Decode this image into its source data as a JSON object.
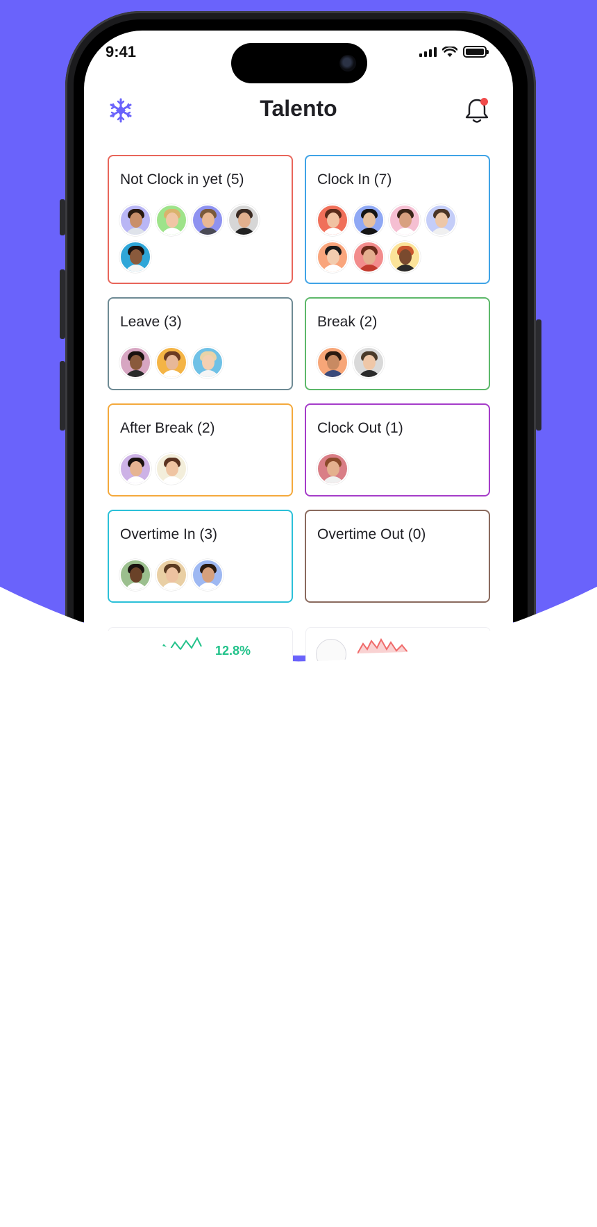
{
  "status_bar": {
    "time": "9:41"
  },
  "header": {
    "title": "Talento",
    "logo_icon": "snowflake-logo-icon",
    "bell_icon": "bell-icon"
  },
  "colors": {
    "background": "#6A63FB",
    "accent": "#6A63FB",
    "notification_dot": "#F04A4A"
  },
  "cards": [
    {
      "title": "Not Clock in yet (5)",
      "border": "#E8655A",
      "avatars": [
        {
          "bg": "#B9B6F5",
          "skin": "#C98F6A",
          "hair": "#2a1a10",
          "shirt": "#dfe3ea"
        },
        {
          "bg": "#9EE38A",
          "skin": "#F0C6A5",
          "hair": "#D9B36C",
          "shirt": "#ffffff"
        },
        {
          "bg": "#8E92F0",
          "skin": "#E9B894",
          "hair": "#7a5a3a",
          "shirt": "#4a4a55"
        },
        {
          "bg": "#D6D6D6",
          "skin": "#E2B08E",
          "hair": "#3a2a22",
          "shirt": "#222222"
        },
        {
          "bg": "#2FA6D8",
          "skin": "#8A5A3C",
          "hair": "#1a1210",
          "shirt": "#f5f5f5"
        }
      ]
    },
    {
      "title": "Clock In (7)",
      "border": "#3FA3E6",
      "avatars": [
        {
          "bg": "#F0705A",
          "skin": "#F1C2A2",
          "hair": "#5a2a1a",
          "shirt": "#ffffff"
        },
        {
          "bg": "#8FA8F4",
          "skin": "#E7C09E",
          "hair": "#151515",
          "shirt": "#141414"
        },
        {
          "bg": "#F5BFD2",
          "skin": "#D8A080",
          "hair": "#3a2418",
          "shirt": "#ffffff"
        },
        {
          "bg": "#C4CDF8",
          "skin": "#EDC7A8",
          "hair": "#4a3426",
          "shirt": "#f0f0f0"
        },
        {
          "bg": "#F9A57C",
          "skin": "#F3CCAE",
          "hair": "#1a1a1a",
          "shirt": "#ffffff"
        },
        {
          "bg": "#F28C8C",
          "skin": "#E4AE8E",
          "hair": "#6a2a1a",
          "shirt": "#C23B2E"
        },
        {
          "bg": "#FBE39A",
          "skin": "#7A4A2E",
          "hair": "#C9552E",
          "shirt": "#2a2a2a"
        }
      ]
    },
    {
      "title": "Leave (3)",
      "border": "#6E8A94",
      "avatars": [
        {
          "bg": "#D7A6C2",
          "skin": "#8A5A3C",
          "hair": "#1a1210",
          "shirt": "#2a2a2a"
        },
        {
          "bg": "#F4B445",
          "skin": "#E7B898",
          "hair": "#6a3a22",
          "shirt": "#ffffff"
        },
        {
          "bg": "#6FC1E6",
          "skin": "#F3D0B2",
          "hair": "#E8D3A8",
          "shirt": "#f5f5f5"
        }
      ]
    },
    {
      "title": "Break (2)",
      "border": "#5DB86A",
      "avatars": [
        {
          "bg": "#F7A678",
          "skin": "#C88A62",
          "hair": "#2a1a10",
          "shirt": "#3a4a7a"
        },
        {
          "bg": "#D9D9D9",
          "skin": "#EFC7A8",
          "hair": "#4a3a2a",
          "shirt": "#2a2a2a"
        }
      ]
    },
    {
      "title": "After Break (2)",
      "border": "#F4A93C",
      "avatars": [
        {
          "bg": "#CDB2E6",
          "skin": "#E6B492",
          "hair": "#1a1210",
          "shirt": "#ffffff"
        },
        {
          "bg": "#F3EEDB",
          "skin": "#EFC4A2",
          "hair": "#5a3220",
          "shirt": "#ffffff"
        }
      ]
    },
    {
      "title": "Clock Out (1)",
      "border": "#A53CC9",
      "avatars": [
        {
          "bg": "#D97E86",
          "skin": "#E4B08E",
          "hair": "#8a4a2a",
          "shirt": "#f0f0f0"
        }
      ]
    },
    {
      "title": "Overtime In (3)",
      "border": "#2BC0D8",
      "avatars": [
        {
          "bg": "#9BBF8E",
          "skin": "#6A4228",
          "hair": "#1a1210",
          "shirt": "#ffffff"
        },
        {
          "bg": "#E9CFA4",
          "skin": "#EDC2A0",
          "hair": "#5a3a22",
          "shirt": "#ffffff"
        },
        {
          "bg": "#9EB8F2",
          "skin": "#D6A07C",
          "hair": "#2a1a10",
          "shirt": "#ffffff"
        }
      ]
    },
    {
      "title": "Overtime Out (0)",
      "border": "#8A6A5E",
      "avatars": []
    }
  ],
  "peek": {
    "percent": "12.8%"
  }
}
